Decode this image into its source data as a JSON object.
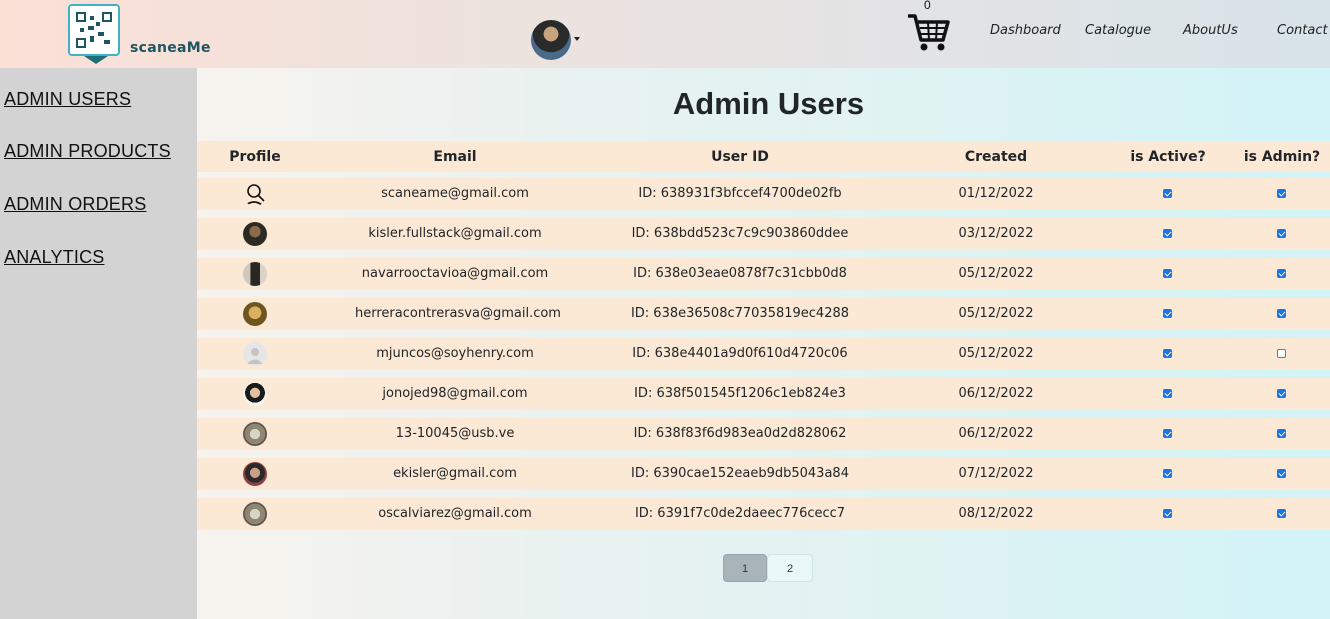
{
  "header": {
    "logo_text": "scaneaMe",
    "cart_count": "0",
    "nav": [
      "Dashboard",
      "Catalogue",
      "AboutUs",
      "Contact"
    ]
  },
  "sidebar": {
    "items": [
      "ADMIN USERS",
      "ADMIN PRODUCTS",
      "ADMIN ORDERS",
      "ANALYTICS"
    ]
  },
  "main": {
    "title": "Admin Users",
    "columns": [
      "Profile",
      "Email",
      "User ID",
      "Created",
      "is Active?",
      "is Admin?"
    ],
    "rows": [
      {
        "email": "scaneame@gmail.com",
        "user_id": "ID: 638931f3bfccef4700de02fb",
        "created": "01/12/2022",
        "active": true,
        "admin": true,
        "avatar": "user-outline-icon"
      },
      {
        "email": "kisler.fullstack@gmail.com",
        "user_id": "ID: 638bdd523c7c9c903860ddee",
        "created": "03/12/2022",
        "active": true,
        "admin": true,
        "avatar": "photo"
      },
      {
        "email": "navarrooctavioa@gmail.com",
        "user_id": "ID: 638e03eae0878f7c31cbb0d8",
        "created": "05/12/2022",
        "active": true,
        "admin": true,
        "avatar": "photo"
      },
      {
        "email": "herreracontrerasva@gmail.com",
        "user_id": "ID: 638e36508c77035819ec4288",
        "created": "05/12/2022",
        "active": true,
        "admin": true,
        "avatar": "photo"
      },
      {
        "email": "mjuncos@soyhenry.com",
        "user_id": "ID: 638e4401a9d0f610d4720c06",
        "created": "05/12/2022",
        "active": true,
        "admin": false,
        "avatar": "default-user-icon"
      },
      {
        "email": "jonojed98@gmail.com",
        "user_id": "ID: 638f501545f1206c1eb824e3",
        "created": "06/12/2022",
        "active": true,
        "admin": true,
        "avatar": "photo"
      },
      {
        "email": "13-10045@usb.ve",
        "user_id": "ID: 638f83f6d983ea0d2d828062",
        "created": "06/12/2022",
        "active": true,
        "admin": true,
        "avatar": "photo"
      },
      {
        "email": "ekisler@gmail.com",
        "user_id": "ID: 6390cae152eaeb9db5043a84",
        "created": "07/12/2022",
        "active": true,
        "admin": true,
        "avatar": "photo"
      },
      {
        "email": "oscalviarez@gmail.com",
        "user_id": "ID: 6391f7c0de2daeec776cecc7",
        "created": "08/12/2022",
        "active": true,
        "admin": true,
        "avatar": "photo"
      }
    ],
    "pagination": {
      "pages": [
        "1",
        "2"
      ],
      "current": "1"
    }
  },
  "colors": {
    "accent_checkbox": "#1a73e8",
    "row_background": "#fbe9d6",
    "sidebar_background": "#d3d3d3"
  }
}
